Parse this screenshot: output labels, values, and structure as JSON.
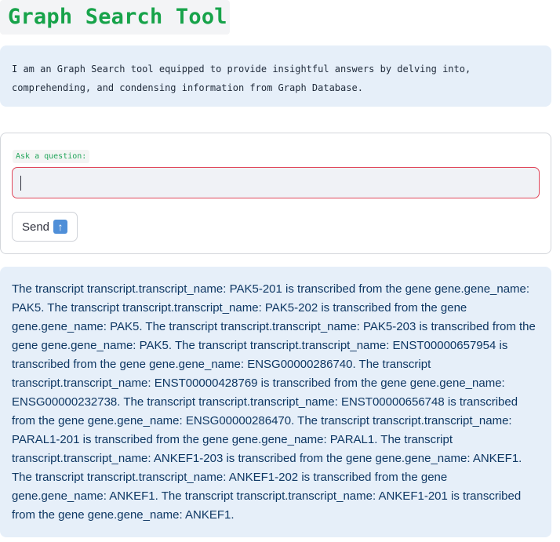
{
  "header": {
    "title": "Graph Search Tool"
  },
  "intro": {
    "text": "I am an Graph Search tool equipped to provide insightful answers by delving into, comprehending, and condensing information from Graph Database."
  },
  "form": {
    "question_label": "Ask a question:",
    "question_value": "",
    "question_placeholder": "",
    "send_label": "Send",
    "send_icon": "up-arrow-icon"
  },
  "answer": {
    "text": "The transcript transcript.transcript_name: PAK5-201 is transcribed from the gene gene.gene_name: PAK5. The transcript transcript.transcript_name: PAK5-202 is transcribed from the gene gene.gene_name: PAK5. The transcript transcript.transcript_name: PAK5-203 is transcribed from the gene gene.gene_name: PAK5. The transcript transcript.transcript_name: ENST00000657954 is transcribed from the gene gene.gene_name: ENSG00000286740. The transcript transcript.transcript_name: ENST00000428769 is transcribed from the gene gene.gene_name: ENSG00000232738. The transcript transcript.transcript_name: ENST00000656748 is transcribed from the gene gene.gene_name: ENSG00000286470. The transcript transcript.transcript_name: PARAL1-201 is transcribed from the gene gene.gene_name: PARAL1. The transcript transcript.transcript_name: ANKEF1-203 is transcribed from the gene gene.gene_name: ANKEF1. The transcript transcript.transcript_name: ANKEF1-202 is transcribed from the gene gene.gene_name: ANKEF1. The transcript transcript.transcript_name: ANKEF1-201 is transcribed from the gene gene.gene_name: ANKEF1."
  },
  "colors": {
    "title": "#17a34a",
    "info_background": "#e6eff9",
    "input_border_focus": "#e0485c",
    "answer_text": "#0e3763"
  }
}
